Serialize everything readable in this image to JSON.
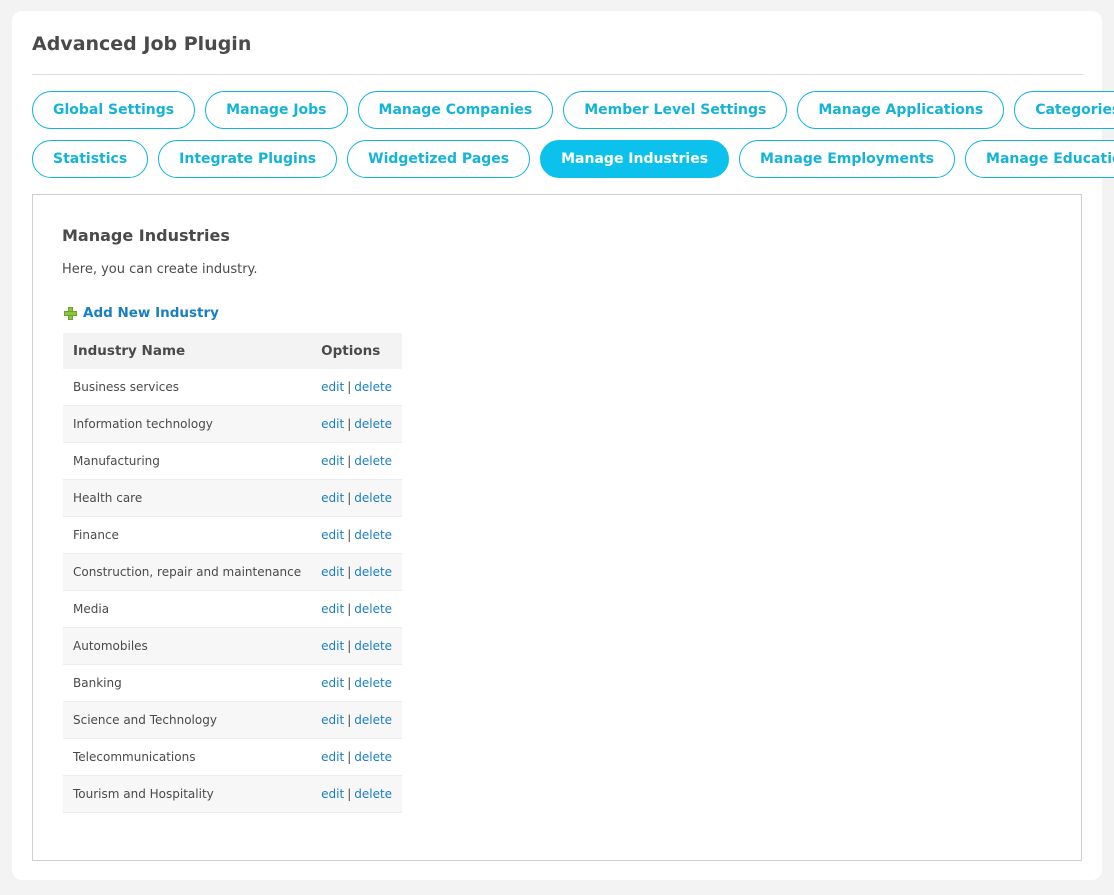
{
  "app": {
    "title": "Advanced Job Plugin"
  },
  "tabs": [
    {
      "label": "Global Settings",
      "active": false
    },
    {
      "label": "Manage Jobs",
      "active": false
    },
    {
      "label": "Manage Companies",
      "active": false
    },
    {
      "label": "Member Level Settings",
      "active": false
    },
    {
      "label": "Manage Applications",
      "active": false
    },
    {
      "label": "Categories",
      "active": false
    },
    {
      "label": "Statistics",
      "active": false
    },
    {
      "label": "Integrate Plugins",
      "active": false
    },
    {
      "label": "Widgetized Pages",
      "active": false
    },
    {
      "label": "Manage Industries",
      "active": true
    },
    {
      "label": "Manage Employments",
      "active": false
    },
    {
      "label": "Manage Educations",
      "active": false
    }
  ],
  "panel": {
    "title": "Manage Industries",
    "description": "Here, you can create industry.",
    "add_link": "Add New Industry",
    "table": {
      "headers": [
        "Industry Name",
        "Options"
      ],
      "edit_label": "edit",
      "delete_label": "delete",
      "separator": "|",
      "rows": [
        "Business services",
        "Information technology",
        "Manufacturing",
        "Health care",
        "Finance",
        "Construction, repair and maintenance",
        "Media",
        "Automobiles",
        "Banking",
        "Science and Technology",
        "Telecommunications",
        "Tourism and Hospitality"
      ]
    }
  },
  "colors": {
    "accent": "#0cc2ec",
    "link": "#1a7fc1",
    "add_icon": "#8cc43f"
  },
  "icons": {
    "add": "plus-icon"
  }
}
